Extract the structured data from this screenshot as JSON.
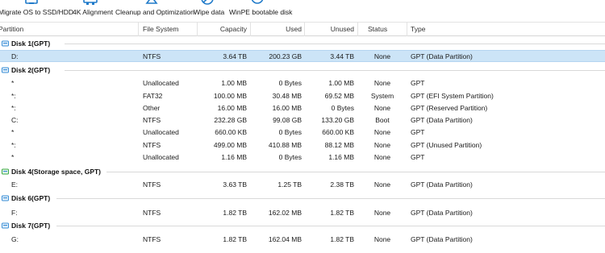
{
  "toolbar": {
    "buttons": [
      {
        "label": "Migrate OS to SSD/HDD",
        "icon": "migrate-os-icon"
      },
      {
        "label": "4K Alignment",
        "icon": "4k-alignment-icon"
      },
      {
        "label": "Cleanup and Optimization",
        "icon": "cleanup-icon"
      },
      {
        "label": "Wipe data",
        "icon": "wipe-data-icon"
      },
      {
        "label": "WinPE bootable disk",
        "icon": "winpe-icon"
      }
    ]
  },
  "columns": [
    "Partition",
    "File System",
    "Capacity",
    "Used",
    "Unused",
    "Status",
    "Type"
  ],
  "disks": [
    {
      "name": "Disk 1(GPT)",
      "partitions": [
        {
          "partition": "D:",
          "fs": "NTFS",
          "capacity": "3.64 TB",
          "used": "200.23 GB",
          "unused": "3.44 TB",
          "status": "None",
          "type": "GPT (Data Partition)",
          "selected": true
        }
      ]
    },
    {
      "name": "Disk 2(GPT)",
      "partitions": [
        {
          "partition": "*",
          "fs": "Unallocated",
          "capacity": "1.00 MB",
          "used": "0 Bytes",
          "unused": "1.00 MB",
          "status": "None",
          "type": "GPT"
        },
        {
          "partition": "*:",
          "fs": "FAT32",
          "capacity": "100.00 MB",
          "used": "30.48 MB",
          "unused": "69.52 MB",
          "status": "System",
          "type": "GPT (EFI System Partition)"
        },
        {
          "partition": "*:",
          "fs": "Other",
          "capacity": "16.00 MB",
          "used": "16.00 MB",
          "unused": "0 Bytes",
          "status": "None",
          "type": "GPT (Reserved Partition)"
        },
        {
          "partition": "C:",
          "fs": "NTFS",
          "capacity": "232.28 GB",
          "used": "99.08 GB",
          "unused": "133.20 GB",
          "status": "Boot",
          "type": "GPT (Data Partition)"
        },
        {
          "partition": "*",
          "fs": "Unallocated",
          "capacity": "660.00 KB",
          "used": "0 Bytes",
          "unused": "660.00 KB",
          "status": "None",
          "type": "GPT"
        },
        {
          "partition": "*:",
          "fs": "NTFS",
          "capacity": "499.00 MB",
          "used": "410.88 MB",
          "unused": "88.12 MB",
          "status": "None",
          "type": "GPT (Unused Partition)"
        },
        {
          "partition": "*",
          "fs": "Unallocated",
          "capacity": "1.16 MB",
          "used": "0 Bytes",
          "unused": "1.16 MB",
          "status": "None",
          "type": "GPT"
        }
      ]
    },
    {
      "name": "Disk 4(Storage space, GPT)",
      "partitions": [
        {
          "partition": "E:",
          "fs": "NTFS",
          "capacity": "3.63 TB",
          "used": "1.25 TB",
          "unused": "2.38 TB",
          "status": "None",
          "type": "GPT (Data Partition)"
        }
      ]
    },
    {
      "name": "Disk 6(GPT)",
      "partitions": [
        {
          "partition": "F:",
          "fs": "NTFS",
          "capacity": "1.82 TB",
          "used": "162.02 MB",
          "unused": "1.82 TB",
          "status": "None",
          "type": "GPT (Data Partition)"
        }
      ]
    },
    {
      "name": "Disk 7(GPT)",
      "partitions": [
        {
          "partition": "G:",
          "fs": "NTFS",
          "capacity": "1.82 TB",
          "used": "162.04 MB",
          "unused": "1.82 TB",
          "status": "None",
          "type": "GPT (Data Partition)"
        }
      ]
    }
  ],
  "colors": {
    "selection": "#cce4f7",
    "icon_blue": "#1f7ac9",
    "disk_icon": "#3a8fd6",
    "storage_icon": "#39a845"
  }
}
